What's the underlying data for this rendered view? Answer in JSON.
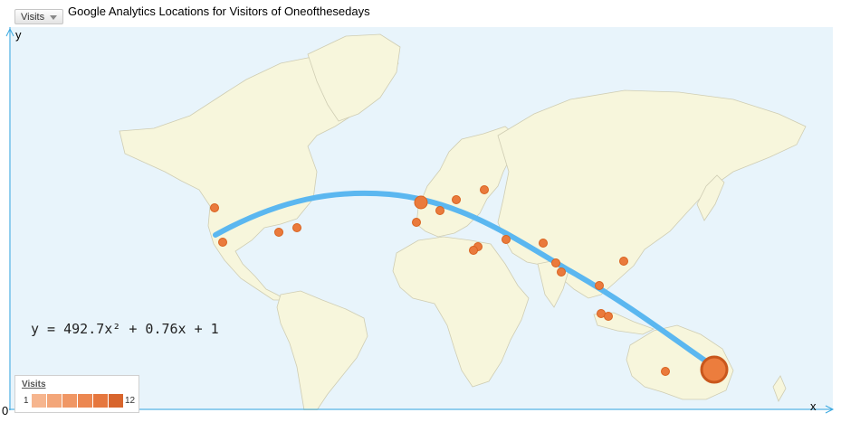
{
  "header": {
    "metric_button_label": "Visits",
    "title": "Google Analytics Locations for Visitors of Oneofthesedays"
  },
  "axes": {
    "y_label": "y",
    "x_label": "x",
    "origin_label": "0"
  },
  "equation": "y = 492.7x² + 0.76x + 1",
  "legend": {
    "title": "Visits",
    "min": "1",
    "max": "12",
    "ramp_colors": [
      "#f6b58e",
      "#f3a679",
      "#f09765",
      "#ec8751",
      "#e6773e",
      "#d8652d",
      "#bf5520"
    ]
  },
  "colors": {
    "ocean": "#e8f4fb",
    "land": "#f7f6dc",
    "land_border": "#cfcdb3",
    "curve": "#5bb7f0",
    "marker": "#ea7a3c",
    "frame": "#3aa8e0"
  },
  "markers": [
    {
      "name": "seattle",
      "size": "small"
    },
    {
      "name": "los-angeles",
      "size": "small"
    },
    {
      "name": "kansas",
      "size": "small"
    },
    {
      "name": "ohio",
      "size": "small"
    },
    {
      "name": "london",
      "size": "medium"
    },
    {
      "name": "paris",
      "size": "small"
    },
    {
      "name": "madrid",
      "size": "small"
    },
    {
      "name": "berlin",
      "size": "small"
    },
    {
      "name": "moscow",
      "size": "small"
    },
    {
      "name": "istanbul",
      "size": "small"
    },
    {
      "name": "cairo",
      "size": "small"
    },
    {
      "name": "riyadh",
      "size": "small"
    },
    {
      "name": "delhi",
      "size": "small"
    },
    {
      "name": "mumbai",
      "size": "small"
    },
    {
      "name": "bangkok",
      "size": "small"
    },
    {
      "name": "hong-kong",
      "size": "small"
    },
    {
      "name": "singapore",
      "size": "small"
    },
    {
      "name": "jakarta",
      "size": "small"
    },
    {
      "name": "bali",
      "size": "small"
    },
    {
      "name": "melbourne",
      "size": "small"
    },
    {
      "name": "sydney",
      "size": "large"
    }
  ]
}
